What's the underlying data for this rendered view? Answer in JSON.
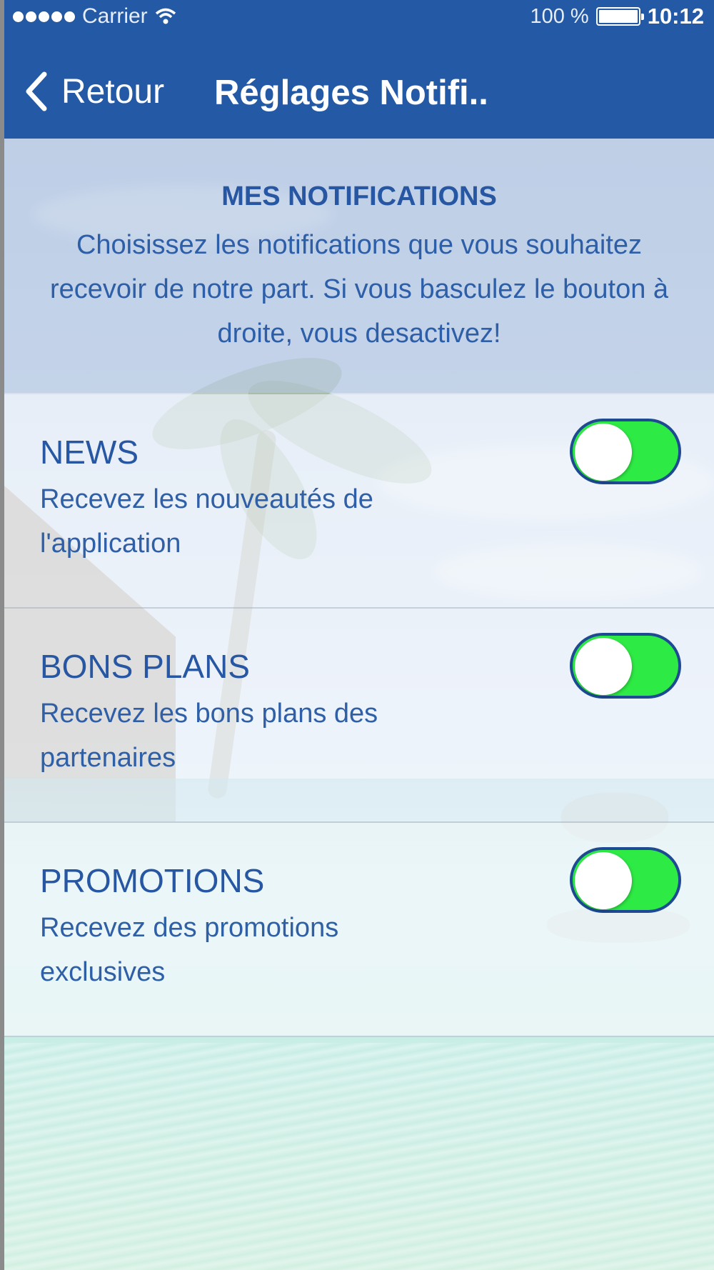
{
  "status_bar": {
    "carrier": "Carrier",
    "battery_percent": "100 %",
    "time": "10:12",
    "signal_icon": "signal-dots-icon",
    "wifi_icon": "wifi-icon",
    "battery_icon": "battery-icon"
  },
  "nav": {
    "back_label": "Retour",
    "back_icon": "chevron-left-icon",
    "title": "Réglages Notifi.."
  },
  "intro": {
    "heading": "MES NOTIFICATIONS",
    "text": "Choisissez les notifications que vous souhaitez recevoir de notre part. Si vous basculez le bouton à droite, vous desactivez!"
  },
  "settings": [
    {
      "title": "NEWS",
      "description": "Recevez les nouveautés de l'application",
      "enabled": true
    },
    {
      "title": "BONS PLANS",
      "description": "Recevez les bons plans des partenaires",
      "enabled": true
    },
    {
      "title": "PROMOTIONS",
      "description": "Recevez des promotions exclusives",
      "enabled": true
    }
  ],
  "colors": {
    "bar_blue": "#2459a5",
    "text_blue": "#2757a3",
    "toggle_green": "#2eea45"
  }
}
